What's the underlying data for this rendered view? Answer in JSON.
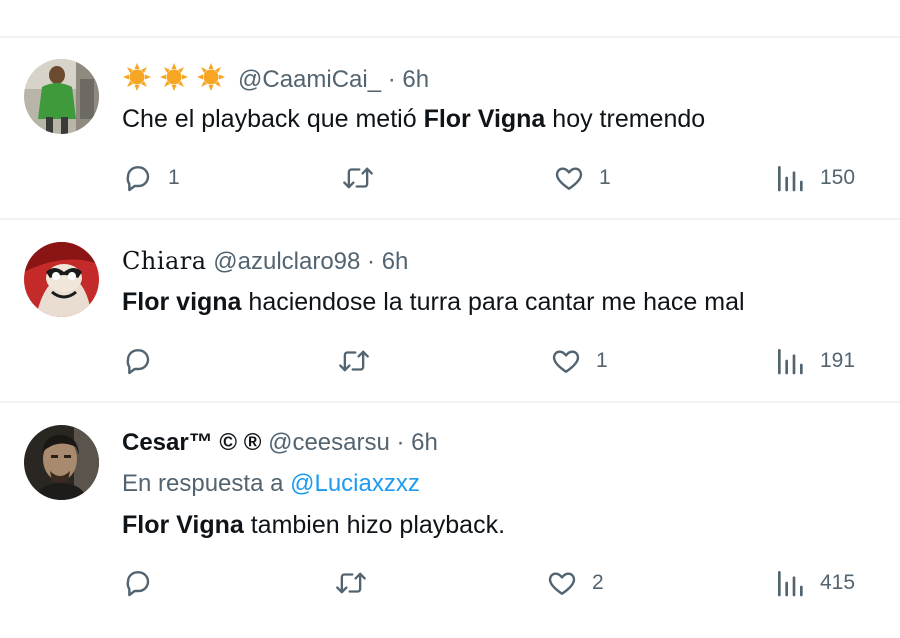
{
  "tweets": [
    {
      "name": "",
      "handle": "@CaamiCai_",
      "time": "6h",
      "reply_prefix": "",
      "reply_mention": "",
      "bold": "Flor Vigna",
      "text_before": "Che el playback que metió ",
      "text_after": " hoy tremendo",
      "replies": "1",
      "retweets": "",
      "likes": "1",
      "views": "150",
      "name_decoration": "three-sun-emojis"
    },
    {
      "name": "Chiara",
      "handle": "@azulclaro98",
      "time": "6h",
      "reply_prefix": "",
      "reply_mention": "",
      "bold": "Flor vigna",
      "text_before": "",
      "text_after": " haciendose la turra para cantar me hace mal",
      "replies": "",
      "retweets": "",
      "likes": "1",
      "views": "191"
    },
    {
      "name": "Cesar™ © ®",
      "handle": "@ceesarsu",
      "time": "6h",
      "reply_prefix": "En respuesta a ",
      "reply_mention": "@Luciaxzxz",
      "bold": "Flor Vigna",
      "text_before": "",
      "text_after": " tambien hizo playback.",
      "replies": "",
      "retweets": "",
      "likes": "2",
      "views": "415"
    }
  ],
  "separator": " · ",
  "colors": {
    "text_primary": "#0f1419",
    "text_secondary": "#536471",
    "link": "#1d9bf0",
    "divider": "#eff3f4",
    "sun": "#f6a623"
  }
}
